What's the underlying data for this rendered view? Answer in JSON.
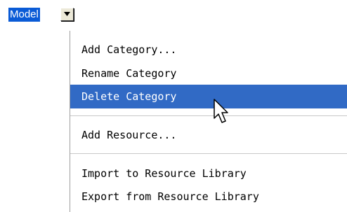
{
  "model": {
    "label": "Model",
    "dropdown_icon": "triangle-down-icon"
  },
  "menu": {
    "items": [
      {
        "label": "Add Category..."
      },
      {
        "label": "Rename Category"
      },
      {
        "label": "Delete Category",
        "highlighted": true
      },
      {
        "label": "Add Resource..."
      },
      {
        "label": "Import to Resource Library"
      },
      {
        "label": "Export from Resource Library"
      }
    ]
  },
  "colors": {
    "selection": "#316ac5",
    "label_highlight": "#0a5bd6"
  },
  "cursor": "arrow-cursor-icon"
}
